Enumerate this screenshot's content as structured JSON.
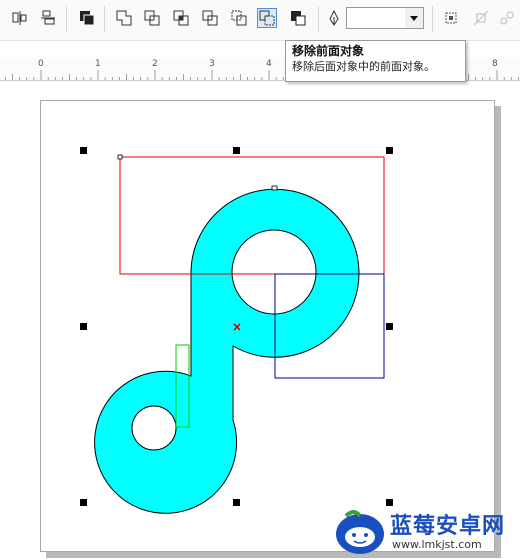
{
  "tooltip": {
    "title": "移除前面对象",
    "description": "移除后面对象中的前面对象。"
  },
  "toolbar": {
    "buttons": [
      {
        "name": "align-distribute-icon",
        "active": false
      },
      {
        "name": "transform-icon",
        "active": false
      },
      {
        "name": "combine-icon",
        "active": false
      },
      {
        "name": "weld-icon",
        "active": false
      },
      {
        "name": "trim-icon",
        "active": false
      },
      {
        "name": "intersect-icon",
        "active": false
      },
      {
        "name": "simplify-icon",
        "active": false
      },
      {
        "name": "front-minus-back-icon",
        "active": false
      },
      {
        "name": "back-minus-front-icon",
        "active": true
      },
      {
        "name": "create-boundary-icon",
        "active": false
      }
    ],
    "outline_width_value": ""
  },
  "ruler": {
    "labels": [
      "0",
      "1",
      "2",
      "3",
      "4",
      "8"
    ]
  },
  "colors": {
    "shape_fill": "#00ffff",
    "rect_red": "#dd0000",
    "rect_blue": "#00008b",
    "rect_green": "#00cc00",
    "tooltip_border": "#9a9a9a",
    "watermark_blue": "#1a4fbf"
  },
  "watermark": {
    "title": "蓝莓安卓网",
    "url": "www.lmkjst.com"
  }
}
